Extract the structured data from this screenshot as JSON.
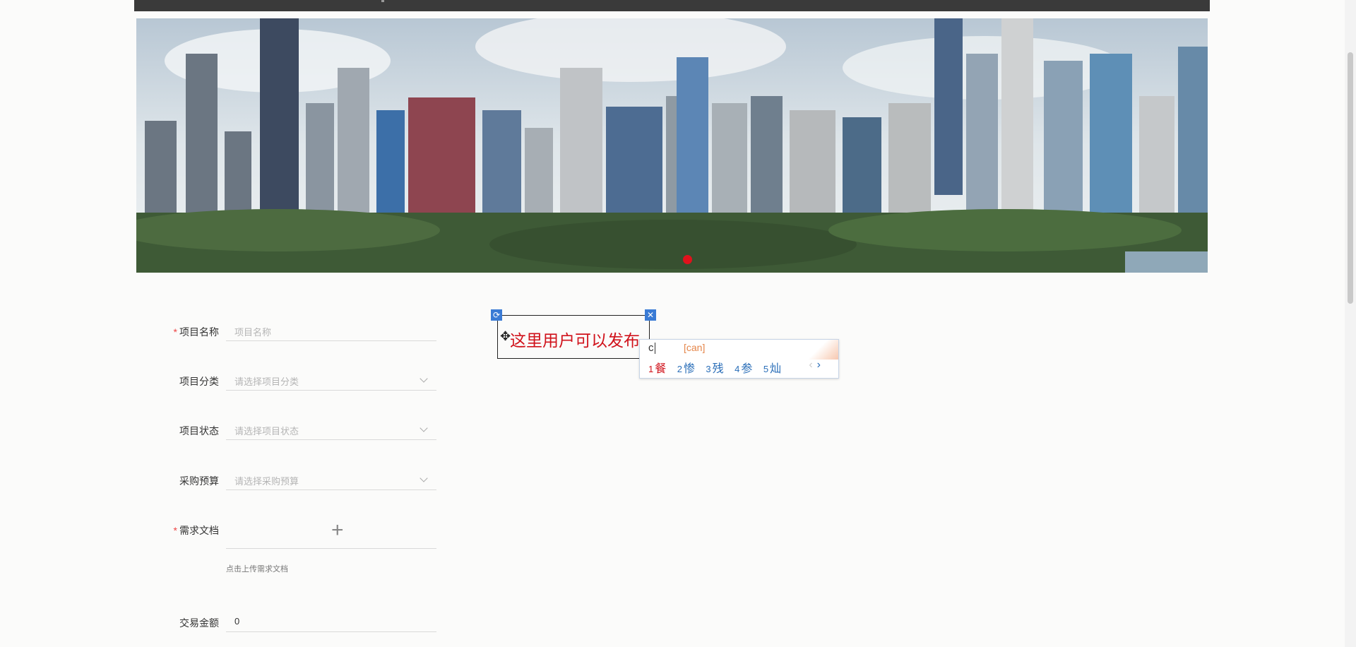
{
  "form": {
    "project_name": {
      "label": "项目名称",
      "required": true,
      "placeholder": "项目名称"
    },
    "project_category": {
      "label": "项目分类",
      "placeholder": "请选择项目分类"
    },
    "project_status": {
      "label": "项目状态",
      "placeholder": "请选择项目状态"
    },
    "procurement_budget": {
      "label": "采购预算",
      "placeholder": "请选择采购预算"
    },
    "requirement_doc": {
      "label": "需求文档",
      "required": true,
      "upload_hint": "点击上传需求文档"
    },
    "transaction_amount": {
      "label": "交易金额",
      "value": "0"
    }
  },
  "text_editor": {
    "text": "这里用户可以发布",
    "rotate_icon": "rotate-icon",
    "close_icon": "close-icon",
    "move_icon": "move-icon"
  },
  "ime": {
    "input": "c",
    "pinyin": "[can]",
    "candidates": [
      {
        "num": "1",
        "char": "餐"
      },
      {
        "num": "2",
        "char": "惨"
      },
      {
        "num": "3",
        "char": "残"
      },
      {
        "num": "4",
        "char": "参"
      },
      {
        "num": "5",
        "char": "灿"
      }
    ],
    "prev": "‹",
    "next": "›"
  },
  "colors": {
    "required": "#ee4444",
    "ime_blue": "#2a6eb8",
    "editor_text": "#d0121b",
    "carousel_dot": "#e0121c"
  }
}
